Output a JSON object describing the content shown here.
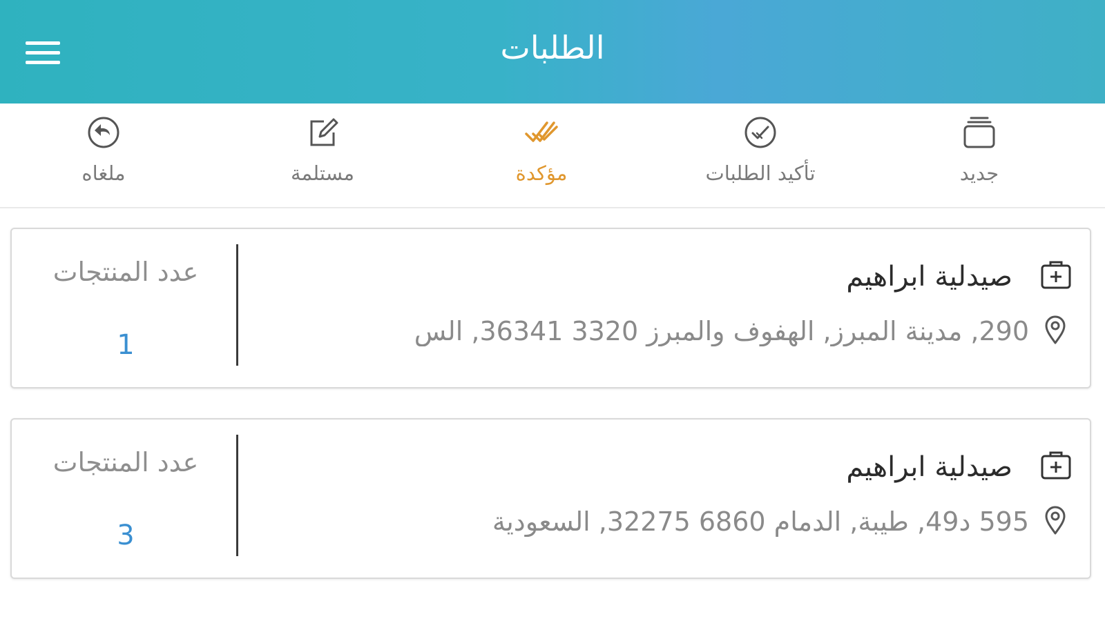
{
  "header": {
    "title": "الطلبات",
    "background_start": "#2fb2bf",
    "background_end": "#4aa8d6"
  },
  "tabs": [
    {
      "label": "ملغاه",
      "icon": "cancelled-icon",
      "active": false
    },
    {
      "label": "مستلمة",
      "icon": "edit-icon",
      "active": false
    },
    {
      "label": "مؤكدة",
      "icon": "double-check-icon",
      "active": true
    },
    {
      "label": "تأكيد الطلبات",
      "icon": "check-circle-icon",
      "active": false
    },
    {
      "label": "جديد",
      "icon": "stack-icon",
      "active": false
    }
  ],
  "colors": {
    "active_tab": "#e0972e",
    "inactive_tab": "#7a7a7a",
    "count_value": "#3a8fd1"
  },
  "orders": [
    {
      "pharmacy_name": "صيدلية ابراهيم",
      "address": "290, مدينة المبرز, الهفوف والمبرز 3320 36341, الس",
      "count_label": "عدد المنتجات",
      "count_value": "1"
    },
    {
      "pharmacy_name": "صيدلية ابراهيم",
      "address": "595 د49, طيبة, الدمام 6860 32275, السعودية",
      "count_label": "عدد المنتجات",
      "count_value": "3"
    }
  ]
}
